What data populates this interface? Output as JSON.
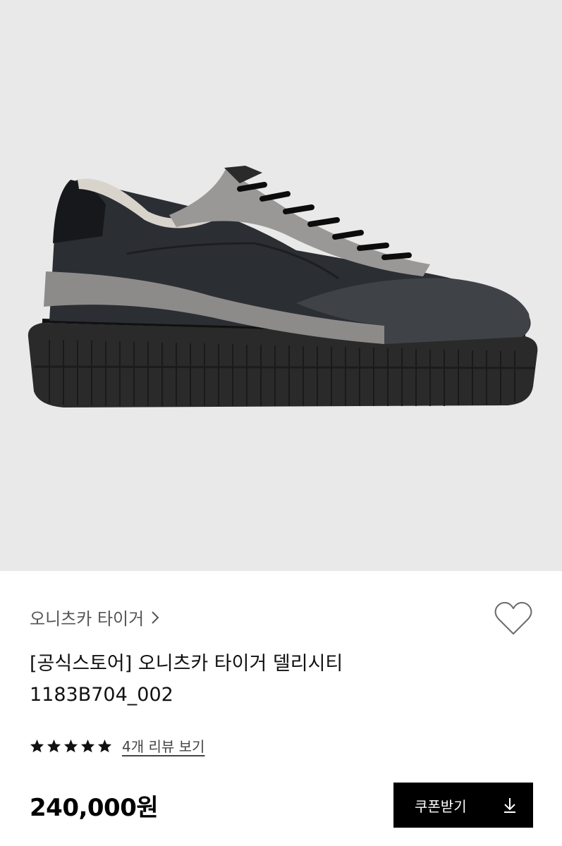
{
  "product_image": {
    "background": "#e9e9e9"
  },
  "brand": {
    "name": "오니츠카 타이거",
    "chevron_icon": "chevron-right-icon"
  },
  "wishlist": {
    "icon": "heart-outline-icon"
  },
  "product": {
    "title_line1": "[공식스토어] 오니츠카 타이거 델리시티",
    "title_line2": "1183B704_002"
  },
  "rating": {
    "stars": 5,
    "star_icon": "star-icon",
    "review_link": "4개 리뷰 보기"
  },
  "price": {
    "amount": "240,000원"
  },
  "coupon": {
    "label": "쿠폰받기",
    "icon": "download-icon",
    "background": "#000000"
  }
}
